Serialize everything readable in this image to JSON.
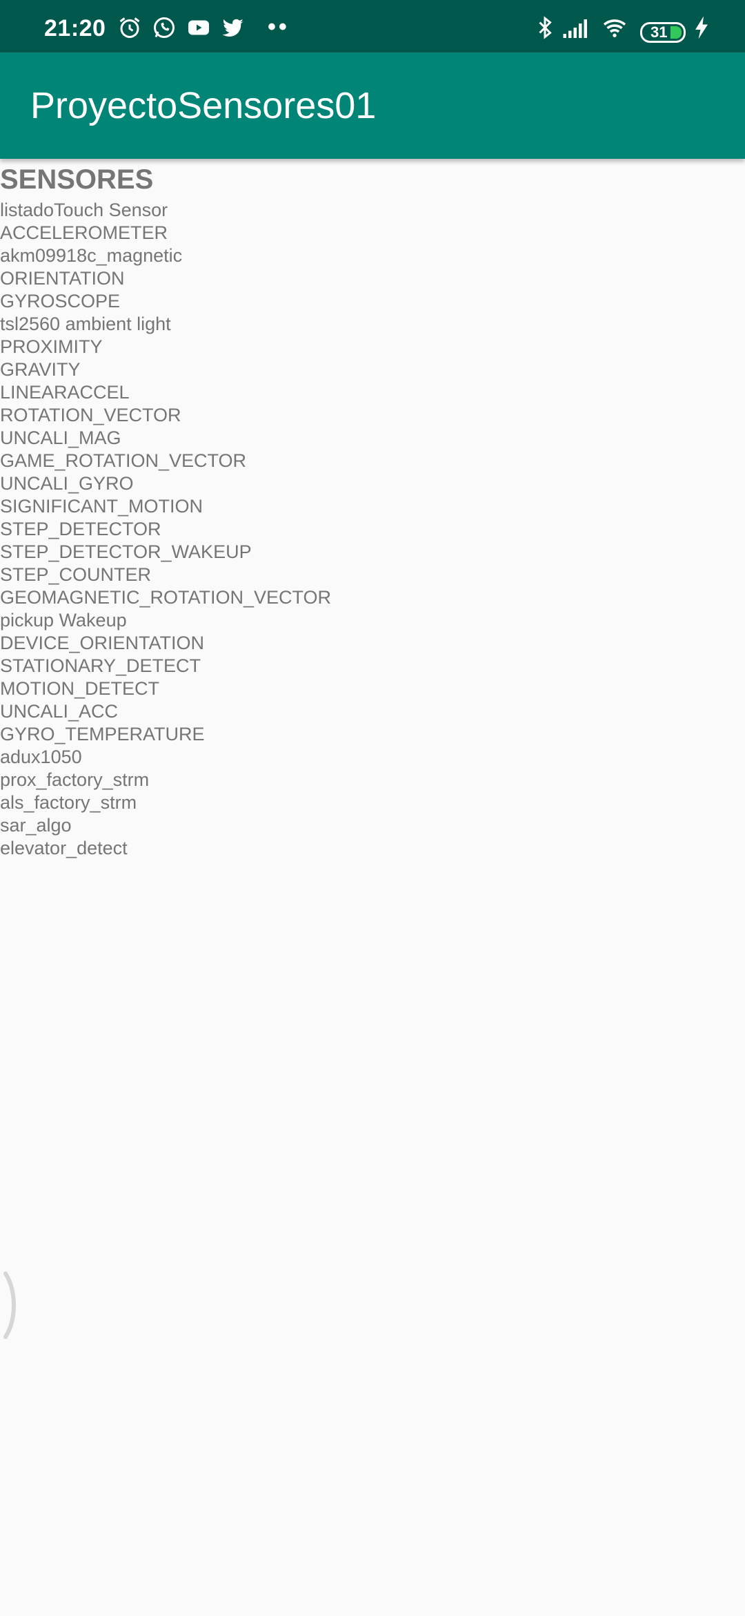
{
  "status_bar": {
    "time": "21:20",
    "battery": "31",
    "icons": [
      "alarm-icon",
      "whatsapp-icon",
      "youtube-icon",
      "twitter-icon",
      "more-dots-icon",
      "bluetooth-icon",
      "signal-icon",
      "wifi-icon",
      "battery-icon",
      "charging-icon"
    ],
    "dots": "••"
  },
  "app_bar": {
    "title": "ProyectoSensores01"
  },
  "colors": {
    "status_bar": "#00574b",
    "app_bar": "#008577",
    "text": "#757575",
    "background": "#fafafa"
  },
  "content": {
    "heading": "SENSORES",
    "sensors": [
      "listadoTouch Sensor",
      "ACCELEROMETER",
      "akm09918c_magnetic",
      "ORIENTATION",
      "GYROSCOPE",
      "tsl2560 ambient light",
      "PROXIMITY",
      "GRAVITY",
      "LINEARACCEL",
      "ROTATION_VECTOR",
      "UNCALI_MAG",
      "GAME_ROTATION_VECTOR",
      "UNCALI_GYRO",
      "SIGNIFICANT_MOTION",
      "STEP_DETECTOR",
      "STEP_DETECTOR_WAKEUP",
      "STEP_COUNTER",
      "GEOMAGNETIC_ROTATION_VECTOR",
      "pickup  Wakeup",
      "DEVICE_ORIENTATION",
      "STATIONARY_DETECT",
      "MOTION_DETECT",
      "UNCALI_ACC",
      "GYRO_TEMPERATURE",
      "adux1050",
      "prox_factory_strm",
      "als_factory_strm",
      "sar_algo",
      "elevator_detect"
    ]
  }
}
